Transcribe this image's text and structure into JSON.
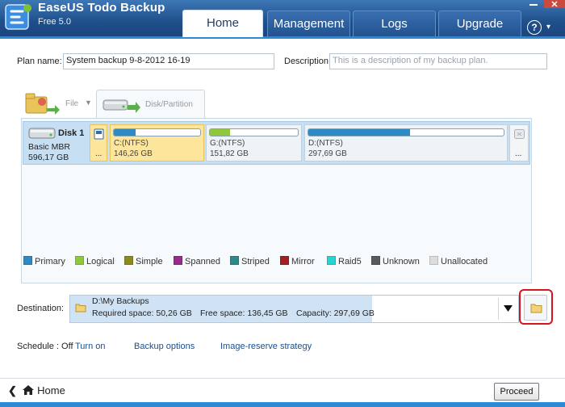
{
  "app": {
    "brand_part1": "EaseUS",
    "brand_part2": "Todo Backup",
    "edition": "Free 5.0"
  },
  "nav": {
    "tabs": [
      {
        "label": "Home",
        "active": true
      },
      {
        "label": "Management",
        "active": false
      },
      {
        "label": "Logs",
        "active": false
      },
      {
        "label": "Upgrade",
        "active": false
      }
    ],
    "help_icon": "?"
  },
  "plan": {
    "name_label": "Plan name:",
    "name_value": "System backup 9-8-2012 16-19",
    "description_label": "Description:",
    "description_placeholder": "This is a description of my backup plan."
  },
  "source_tabs": {
    "file_label": "File",
    "disk_label": "Disk/Partition"
  },
  "disk": {
    "name": "Disk 1",
    "type": "Basic MBR",
    "size": "596,17 GB",
    "small_part_label": "...",
    "more_label": "...",
    "partitions": [
      {
        "name": "C:(NTFS)",
        "size": "146,26 GB",
        "used_fraction": 0.25,
        "selected": true
      },
      {
        "name": "G:(NTFS)",
        "size": "151,82 GB",
        "used_fraction": 0.23,
        "selected": false
      },
      {
        "name": "D:(NTFS)",
        "size": "297,69 GB",
        "used_fraction": 0.52,
        "selected": false
      }
    ]
  },
  "legend": [
    {
      "label": "Primary",
      "color": "#2e8ac4"
    },
    {
      "label": "Logical",
      "color": "#8fc93a"
    },
    {
      "label": "Simple",
      "color": "#8a8a1f"
    },
    {
      "label": "Spanned",
      "color": "#9b2a8e"
    },
    {
      "label": "Striped",
      "color": "#2b8a8a"
    },
    {
      "label": "Mirror",
      "color": "#a42020"
    },
    {
      "label": "Raid5",
      "color": "#27d4d4"
    },
    {
      "label": "Unknown",
      "color": "#5a5a5a"
    },
    {
      "label": "Unallocated",
      "color": "#dcdcdc"
    }
  ],
  "destination": {
    "label": "Destination:",
    "path": "D:\\My Backups",
    "required": "Required space: 50,26 GB",
    "free": "Free space: 136,45 GB",
    "capacity": "Capacity: 297,69 GB"
  },
  "schedule": {
    "status": "Schedule : Off",
    "turn_on": "Turn on",
    "backup_options": "Backup options",
    "image_reserve": "Image-reserve strategy"
  },
  "footer": {
    "home": "Home",
    "proceed": "Proceed"
  },
  "colors": {
    "header": "#1f4f8a",
    "accent": "#2a8ad6",
    "selected_partition": "#fde69b",
    "disk_row": "#c7dff2",
    "highlight_ring": "#d7141c"
  }
}
